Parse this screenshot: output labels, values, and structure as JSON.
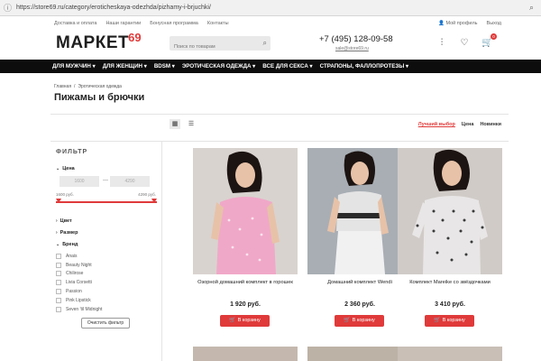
{
  "browser": {
    "url": "https://store69.ru/category/eroticheskaya-odezhda/pizhamy-i-brjuchki/"
  },
  "toplinks": [
    "Доставка и оплата",
    "Наши гарантии",
    "Бонусная программа",
    "Контакты"
  ],
  "account": {
    "profile": "Мой профиль",
    "logout": "Выход"
  },
  "header": {
    "logo_word": "МАРКЕТ",
    "logo_num": "69",
    "search_placeholder": "Поиск по товарам",
    "phone": "+7 (495) 128-09-58",
    "email": "sale@store69.ru",
    "cart_count": "0"
  },
  "nav": [
    "ДЛЯ МУЖЧИН ▾",
    "ДЛЯ ЖЕНЩИН ▾",
    "BDSM ▾",
    "ЭРОТИЧЕСКАЯ ОДЕЖДА ▾",
    "ВСЕ ДЛЯ СЕКСА ▾",
    "СТРАПОНЫ, ФАЛЛОПРОТЕЗЫ ▾"
  ],
  "breadcrumbs": [
    "Главная",
    "/",
    "Эротическая одежда"
  ],
  "page_title": "Пижамы и брючки",
  "sort": {
    "best": "Лучший выбор",
    "price": "Цена",
    "new": "Новинки"
  },
  "filter": {
    "title": "ФИЛЬТР",
    "price_label": "Цена",
    "price_from": "1600",
    "price_to": "4290",
    "range_min": "1600 руб.",
    "range_max": "4290 руб.",
    "color_label": "Цвет",
    "size_label": "Размер",
    "brand_label": "Бренд",
    "brands": [
      "Anais",
      "Beauty Night",
      "Chilirose",
      "Livia Corsetti",
      "Passion",
      "Pink Lipstick",
      "Seven 'til Midnight"
    ],
    "clear_label": "Очистить фильтр"
  },
  "products": [
    {
      "name": "Озорной домашний комплект в горошек",
      "price": "1 920 руб.",
      "buy": "В корзину"
    },
    {
      "name": "Домашний комплект Wendi",
      "price": "2 360 руб.",
      "buy": "В корзину"
    },
    {
      "name": "Комплект Mareike со звёздочками",
      "price": "3 410 руб.",
      "buy": "В корзину"
    }
  ],
  "colors": {
    "accent": "#e03a3a",
    "nav_bg": "#0d0d0d"
  }
}
